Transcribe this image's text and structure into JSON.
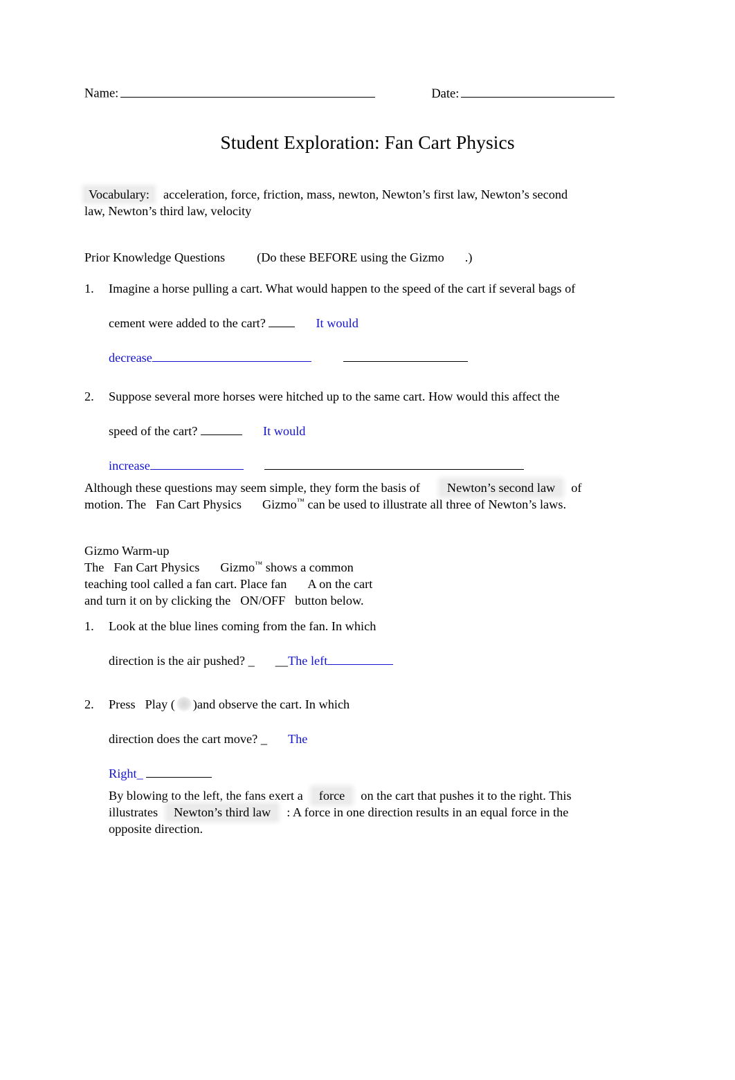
{
  "header": {
    "name_label": "Name:",
    "date_label": "Date:"
  },
  "title": "Student Exploration: Fan Cart Physics",
  "vocabulary": {
    "label": "Vocabulary:",
    "terms_line1": "acceleration, force, friction, mass, newton, Newton’s first law, Newton’s second",
    "terms_line2": "law, Newton’s third law, velocity"
  },
  "prior_knowledge": {
    "heading": "Prior Knowledge Questions",
    "instruction_open": "(Do these BEFORE using the Gizmo",
    "instruction_close": ".)"
  },
  "questions": [
    {
      "number": "1.",
      "line1": "Imagine a horse pulling a cart. What would happen to the speed of the cart if several bags of",
      "line2_text": "cement were added to the cart?",
      "line2_answer": "It would",
      "line3_answer": "decrease"
    },
    {
      "number": "2.",
      "line1": "Suppose several more horses were hitched up to the same cart. How would this affect the",
      "line2_text": "speed of the cart?",
      "line2_answer": "It would",
      "line3_answer": "increase"
    }
  ],
  "bridge_paragraph": {
    "part1": "Although these questions may seem simple, they form the basis of",
    "highlight": "Newton’s second law",
    "part2": "of",
    "line2_a": "motion. The",
    "line2_italic": "Fan Cart Physics",
    "line2_b": "Gizmo",
    "line2_tm": "™",
    "line2_c": "can be used to illustrate all three of Newton’s laws."
  },
  "warmup": {
    "heading": "Gizmo Warm-up",
    "line1_a": "The",
    "line1_italic": "Fan Cart Physics",
    "line1_b": "Gizmo",
    "line1_tm": "™",
    "line1_c": "shows a common",
    "line2_a": "teaching tool called a fan cart. Place fan",
    "line2_b": "A on the cart",
    "line3_a": "and turn it on by clicking the",
    "line3_b": "ON/OFF",
    "line3_c": "button below."
  },
  "warmup_questions": [
    {
      "number": "1.",
      "line1": "Look at the blue lines coming from the fan. In which",
      "line2_text": "direction is the air pushed?",
      "line2_prefix_black": "_",
      "line2_prefix_lead": "__",
      "line2_answer": "The left"
    },
    {
      "number": "2.",
      "line1_a": "Press",
      "line1_play": "Play",
      "line1_paren_open": "(",
      "line1_paren_close": ")",
      "line1_b": "and observe the cart. In which",
      "line2_text": "direction does the cart move?",
      "line2_prefix_black": "_",
      "line2_answer": "The",
      "line3_answer": "Right_"
    }
  ],
  "closing_paragraph": {
    "line1_a": "By blowing to the left, the fans exert a",
    "line1_highlight": "force",
    "line1_b": "on the cart that pushes it to the right. This",
    "line2_a": "illustrates",
    "line2_highlight": "Newton’s third law",
    "line2_b": ": A force in one direction results in an equal force in the",
    "line3": "opposite direction."
  },
  "icons": {
    "play_button": "play-icon-placeholder"
  },
  "colors": {
    "answer_blue": "#1414d2",
    "highlight_gray": "#ebebeb",
    "text_black": "#000000",
    "page_background": "#ffffff"
  }
}
